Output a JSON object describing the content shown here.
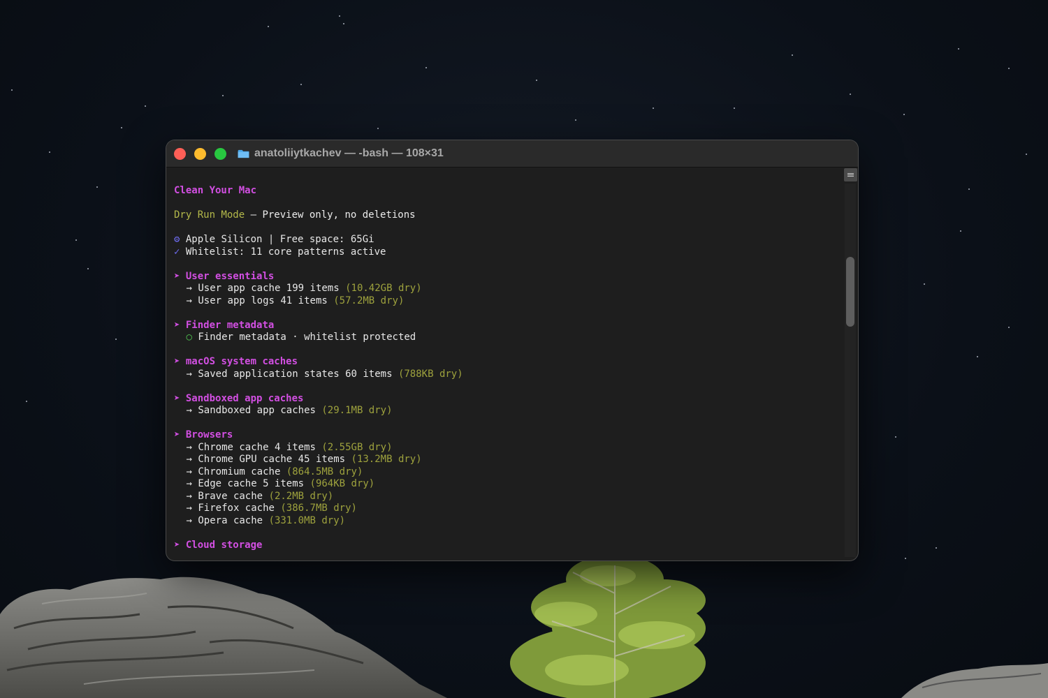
{
  "window": {
    "title": "anatoliiytkachev — -bash — 108×31"
  },
  "terminal": {
    "heading": "Clean Your Mac",
    "mode_label": "Dry Run Mode",
    "mode_desc": " – Preview only, no deletions",
    "system_icon": "⚙",
    "system_info": " Apple Silicon | Free space: 65Gi",
    "whitelist_icon": "✓",
    "whitelist_info": " Whitelist: 11 core patterns active",
    "section_marker": "➤",
    "item_arrow": "→",
    "protected_icon": "○",
    "sections": [
      {
        "title": "User essentials",
        "items": [
          {
            "text": " User app cache 199 items ",
            "size": "(10.42GB dry)"
          },
          {
            "text": " User app logs 41 items ",
            "size": "(57.2MB dry)"
          }
        ]
      },
      {
        "title": "Finder metadata",
        "protected_text": " Finder metadata · whitelist protected"
      },
      {
        "title": "macOS system caches",
        "items": [
          {
            "text": " Saved application states 60 items ",
            "size": "(788KB dry)"
          }
        ]
      },
      {
        "title": "Sandboxed app caches",
        "items": [
          {
            "text": " Sandboxed app caches ",
            "size": "(29.1MB dry)"
          }
        ]
      },
      {
        "title": "Browsers",
        "items": [
          {
            "text": " Chrome cache 4 items ",
            "size": "(2.55GB dry)"
          },
          {
            "text": " Chrome GPU cache 45 items ",
            "size": "(13.2MB dry)"
          },
          {
            "text": " Chromium cache ",
            "size": "(864.5MB dry)"
          },
          {
            "text": " Edge cache 5 items ",
            "size": "(964KB dry)"
          },
          {
            "text": " Brave cache ",
            "size": "(2.2MB dry)"
          },
          {
            "text": " Firefox cache ",
            "size": "(386.7MB dry)"
          },
          {
            "text": " Opera cache ",
            "size": "(331.0MB dry)"
          }
        ]
      },
      {
        "title": "Cloud storage"
      }
    ]
  },
  "colors": {
    "heading": "#d24fe2",
    "mode": "#b4b94a",
    "size": "#9ea23d",
    "info_icon": "#6e6cf0",
    "protected_icon": "#4fbf4f"
  },
  "icons": {
    "close": "close-button",
    "minimize": "minimize-button",
    "zoom": "zoom-button",
    "folder": "folder-icon"
  }
}
